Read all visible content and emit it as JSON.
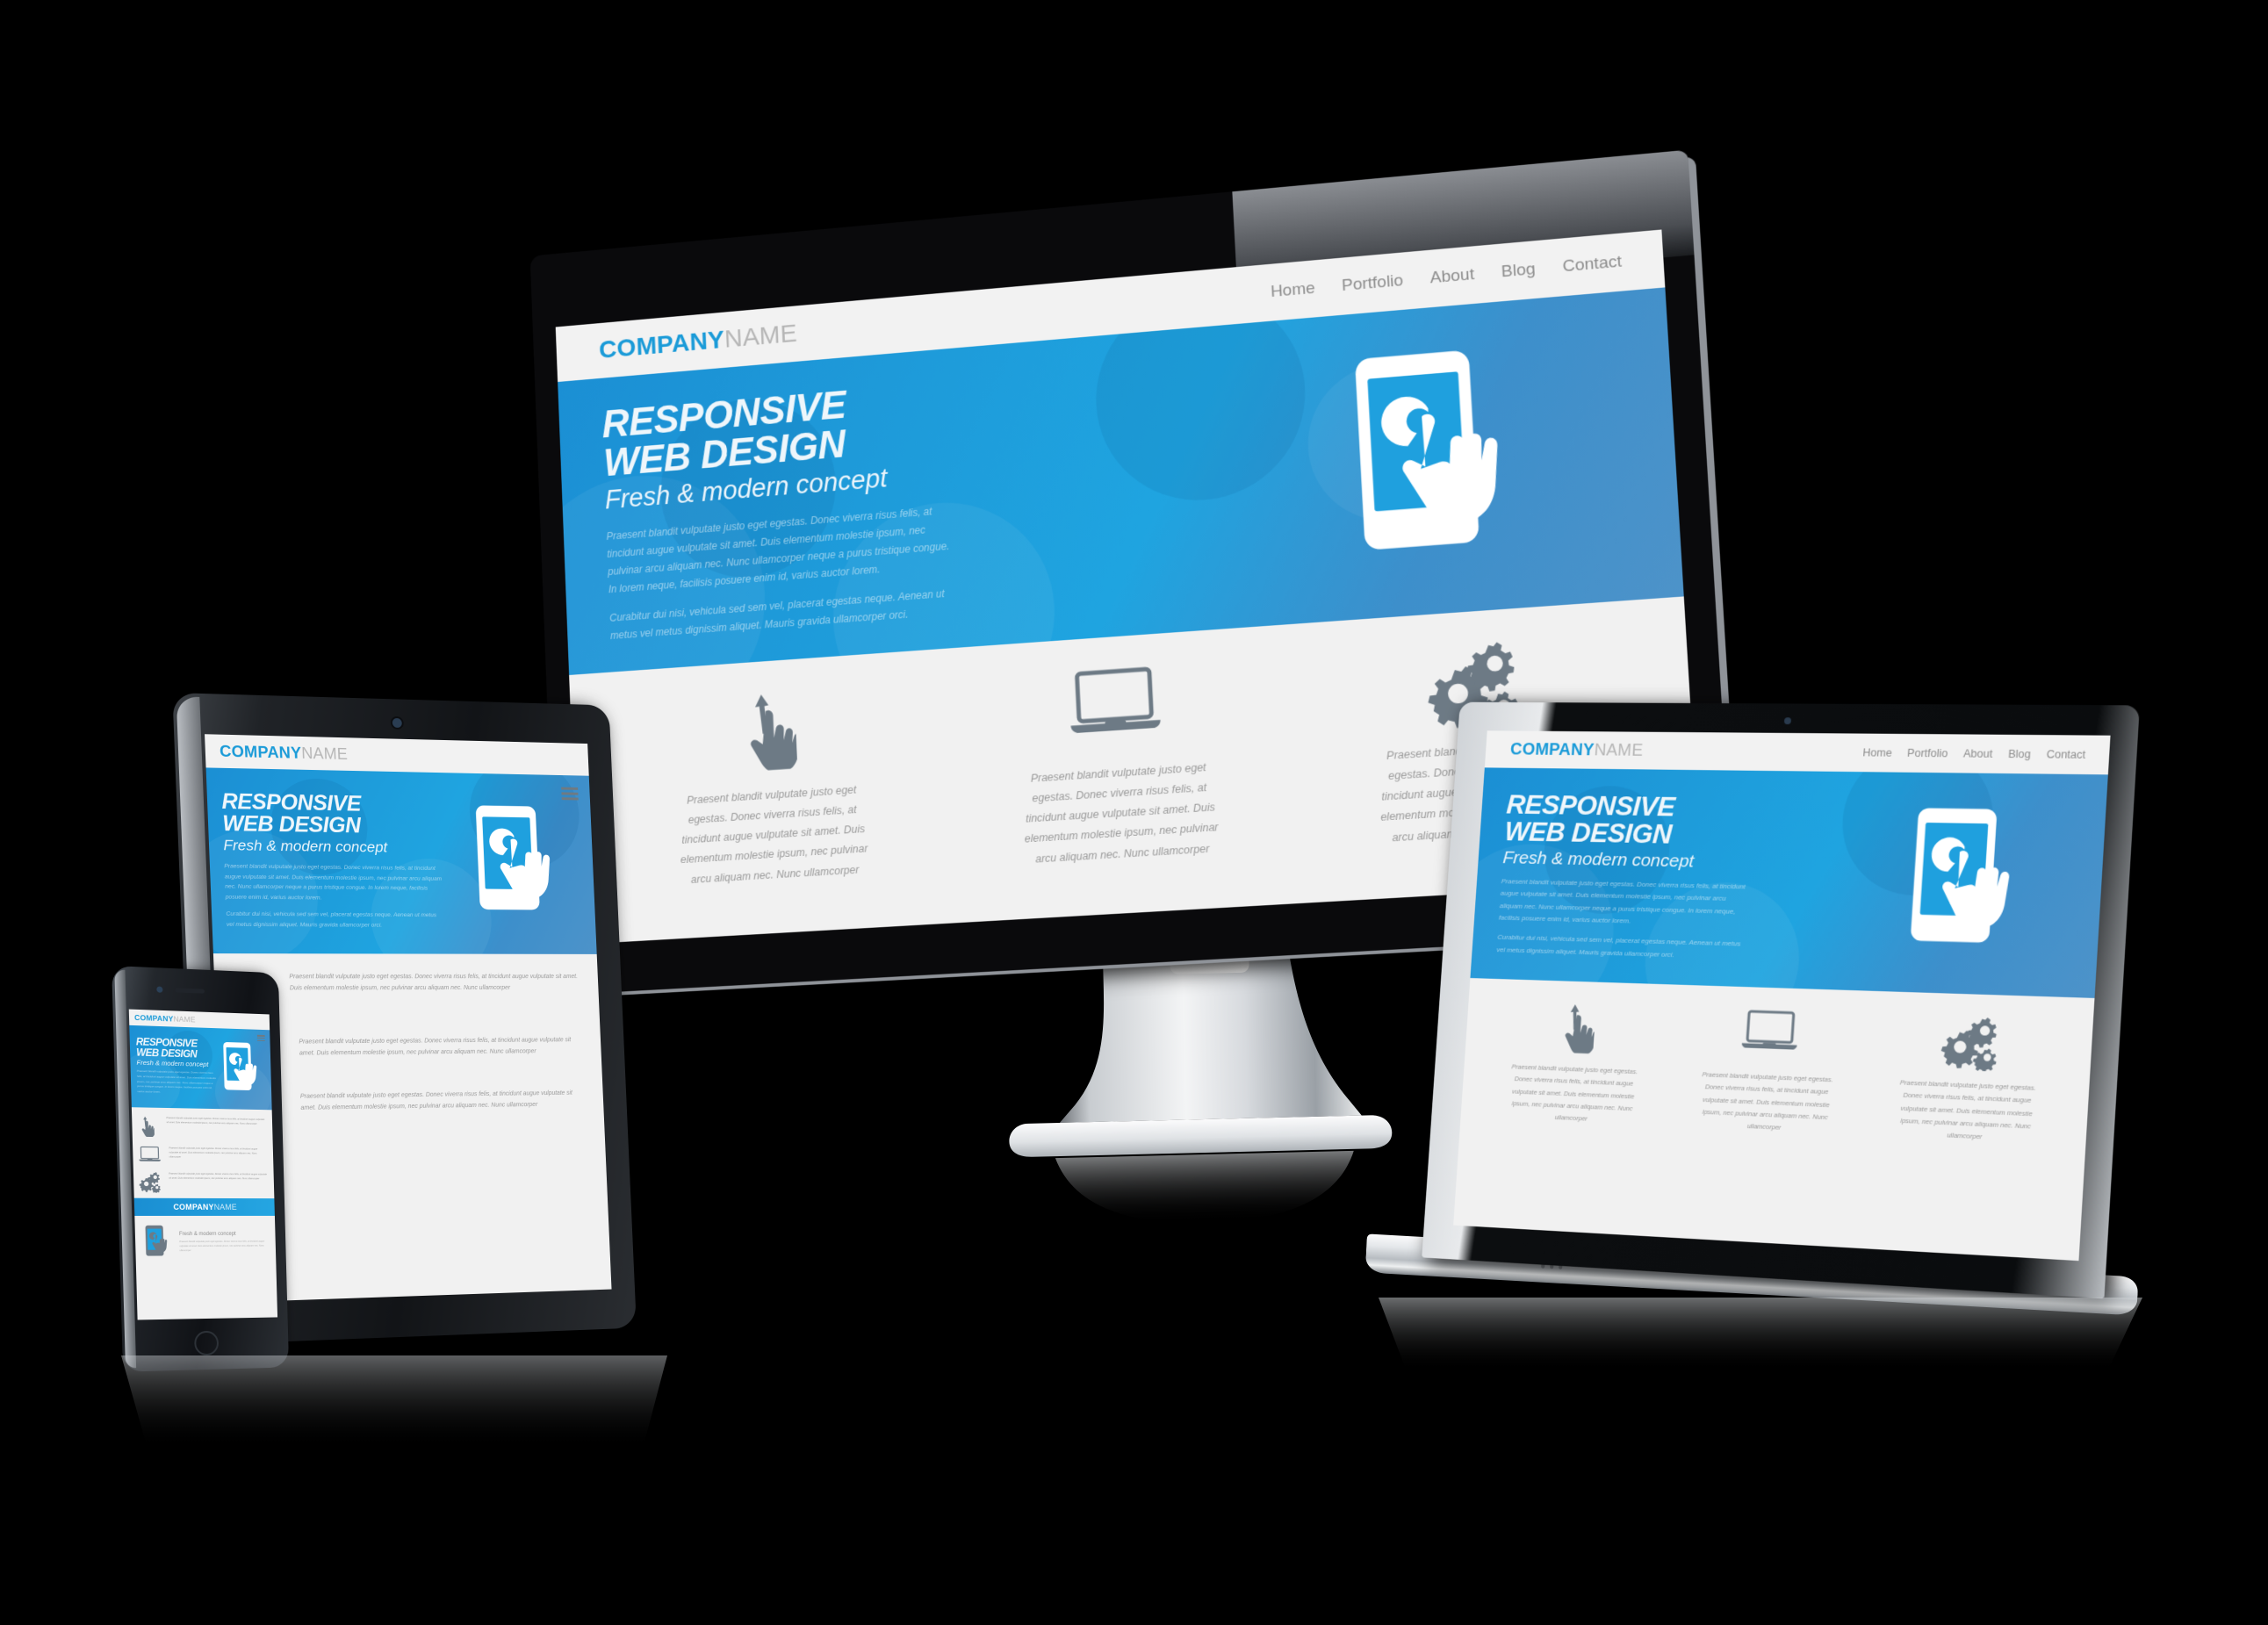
{
  "scene": {
    "title": "Responsive web design device mockup",
    "background_color": "#000000",
    "brand_blue": "#1b9bd8",
    "hero_blue_dark": "#1b8fd4",
    "hero_blue_light": "#1fa4e0",
    "icon_gray": "#6d7a85",
    "body_gray": "#9a9a9a"
  },
  "site": {
    "logo": {
      "bold_part": "COMPANY",
      "light_part": "NAME"
    },
    "nav": [
      {
        "label": "Home"
      },
      {
        "label": "Portfolio"
      },
      {
        "label": "About"
      },
      {
        "label": "Blog"
      },
      {
        "label": "Contact"
      }
    ],
    "hero": {
      "headline_line1": "RESPONSIVE",
      "headline_line2": "WEB DESIGN",
      "subhead": "Fresh & modern concept",
      "paragraph1": "Praesent blandit vulputate justo eget egestas. Donec viverra risus felis, at tincidunt augue vulputate sit amet. Duis elementum molestie ipsum, nec pulvinar arcu aliquam nec. Nunc ullamcorper neque a purus tristique congue. In lorem neque, facilisis posuere enim id, varius auctor lorem.",
      "paragraph2": "Curabitur dui nisi, vehicula sed sem vel, placerat egestas neque. Aenean ut metus vel metus dignissim aliquet. Mauris gravida ullamcorper orci.",
      "graphic": "touch-phone-hand-icon"
    },
    "features": [
      {
        "icon": "pinch-resize-hand-icon",
        "body": "Praesent blandit vulputate justo eget egestas. Donec viverra risus felis, at tincidunt augue vulputate sit amet. Duis elementum molestie ipsum, nec pulvinar arcu aliquam nec. Nunc ullamcorper"
      },
      {
        "icon": "laptop-icon",
        "body": "Praesent blandit vulputate justo eget egestas. Donec viverra risus felis, at tincidunt augue vulputate sit amet. Duis elementum molestie ipsum, nec pulvinar arcu aliquam nec. Nunc ullamcorper"
      },
      {
        "icon": "gears-icon",
        "body": "Praesent blandit vulputate justo eget egestas. Donec viverra risus felis, at tincidunt augue vulputate sit amet. Duis elementum molestie ipsum, nec pulvinar arcu aliquam nec. Nunc ullamcorper"
      }
    ],
    "promo": {
      "icon": "touch-phone-hand-icon",
      "heading": "Fresh & modern concept",
      "body": "Praesent blandit vulputate justo eget egestas. Donec viverra risus felis, at tincidunt augue vulputate sit amet. Duis elementum molestie ipsum, nec pulvinar arcu aliquam nec. Nunc ullamcorper"
    },
    "menu_button": "hamburger-menu-icon"
  },
  "devices": [
    {
      "name": "desktop-monitor",
      "layout": "full-nav-three-column"
    },
    {
      "name": "tablet",
      "layout": "hamburger-stacked"
    },
    {
      "name": "smartphone",
      "layout": "hamburger-stacked-compact"
    },
    {
      "name": "laptop",
      "layout": "full-nav-three-column"
    }
  ]
}
